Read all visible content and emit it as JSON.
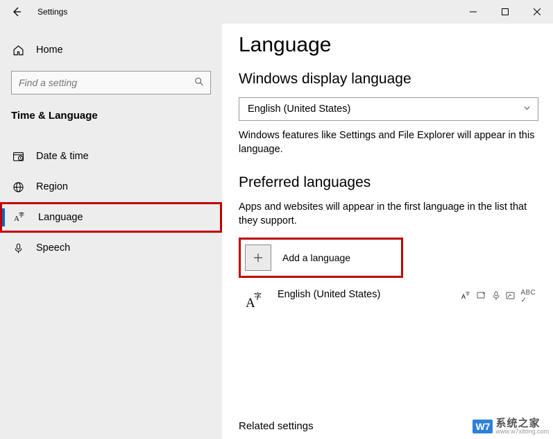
{
  "titlebar": {
    "title": "Settings"
  },
  "sidebar": {
    "home": "Home",
    "search_placeholder": "Find a setting",
    "section": "Time & Language",
    "items": [
      {
        "label": "Date & time"
      },
      {
        "label": "Region"
      },
      {
        "label": "Language"
      },
      {
        "label": "Speech"
      }
    ]
  },
  "content": {
    "title": "Language",
    "display_section": "Windows display language",
    "display_value": "English (United States)",
    "display_desc": "Windows features like Settings and File Explorer will appear in this language.",
    "preferred_section": "Preferred languages",
    "preferred_desc": "Apps and websites will appear in the first language in the list that they support.",
    "add_label": "Add a language",
    "installed_lang": "English (United States)",
    "related": "Related settings"
  },
  "watermark": {
    "logo": "W7",
    "brand": "系统之家",
    "url": "www.w7xitong.com"
  }
}
